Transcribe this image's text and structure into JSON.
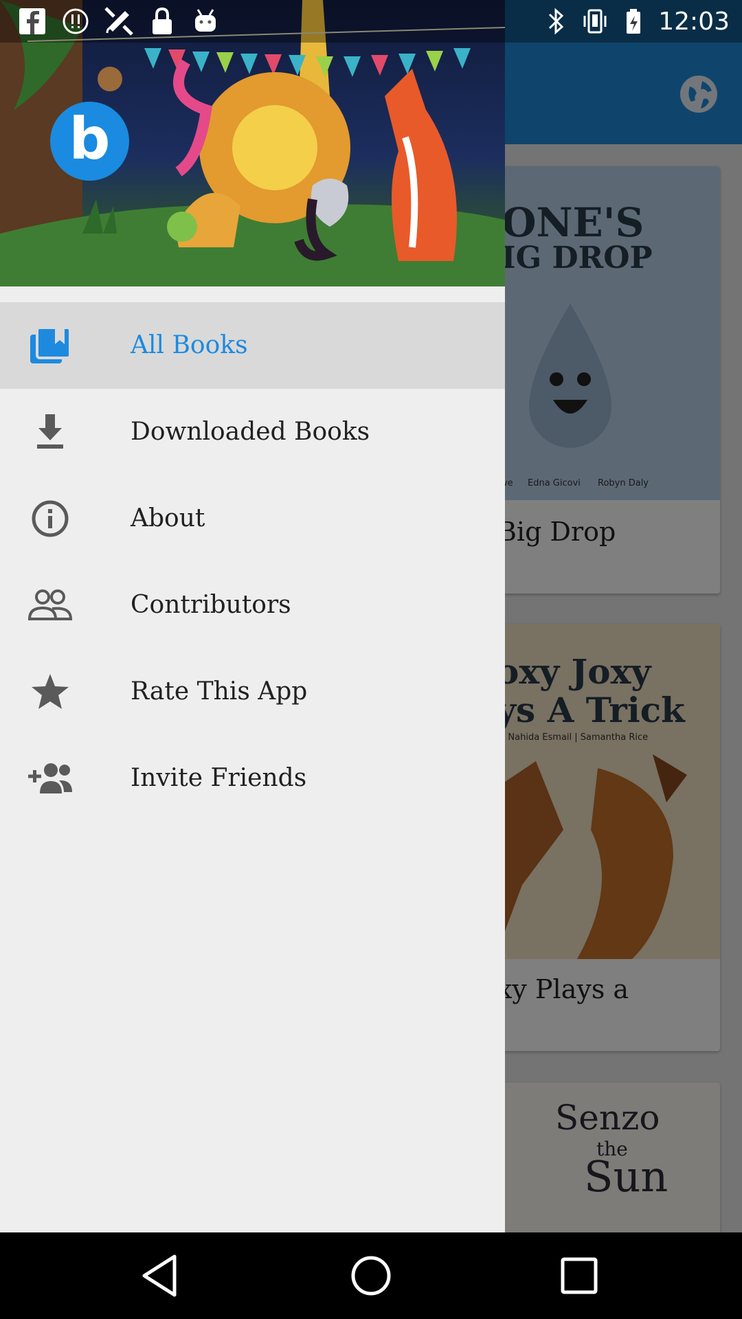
{
  "status_bar": {
    "time": "12:03",
    "left_icons": [
      "facebook-icon",
      "alert-icon",
      "satellite-icon",
      "lock-icon",
      "android-icon"
    ],
    "right_icons": [
      "bluetooth-icon",
      "vibrate-icon",
      "battery-icon"
    ]
  },
  "background": {
    "toolbar_color": "#1f8ad8",
    "books": [
      {
        "cover_lines": [
          "ONE'S",
          "IG DROP"
        ],
        "cover_credits": [
          "owe",
          "Edna Gicovi",
          "Robyn Daly"
        ],
        "title": "Big Drop"
      },
      {
        "cover_lines": [
          "oxy Joxy",
          "ys A Trick"
        ],
        "cover_credits": [
          "s | Nahida Esmail | Samantha Rice"
        ],
        "title": "xy Plays a"
      },
      {
        "cover_lines": [
          "Senzo",
          "the",
          "Sun"
        ],
        "title": ""
      }
    ]
  },
  "drawer": {
    "logo_letter": "b",
    "items": [
      {
        "label": "All Books",
        "icon": "library-books-icon",
        "selected": true
      },
      {
        "label": "Downloaded Books",
        "icon": "download-icon",
        "selected": false
      },
      {
        "label": "About",
        "icon": "info-icon",
        "selected": false
      },
      {
        "label": "Contributors",
        "icon": "people-icon",
        "selected": false
      },
      {
        "label": "Rate This App",
        "icon": "star-icon",
        "selected": false
      },
      {
        "label": "Invite Friends",
        "icon": "group-add-icon",
        "selected": false
      }
    ],
    "accent_color": "#1d8ae0"
  },
  "nav_bar": {
    "buttons": [
      "back-icon",
      "home-icon",
      "recents-icon"
    ]
  }
}
